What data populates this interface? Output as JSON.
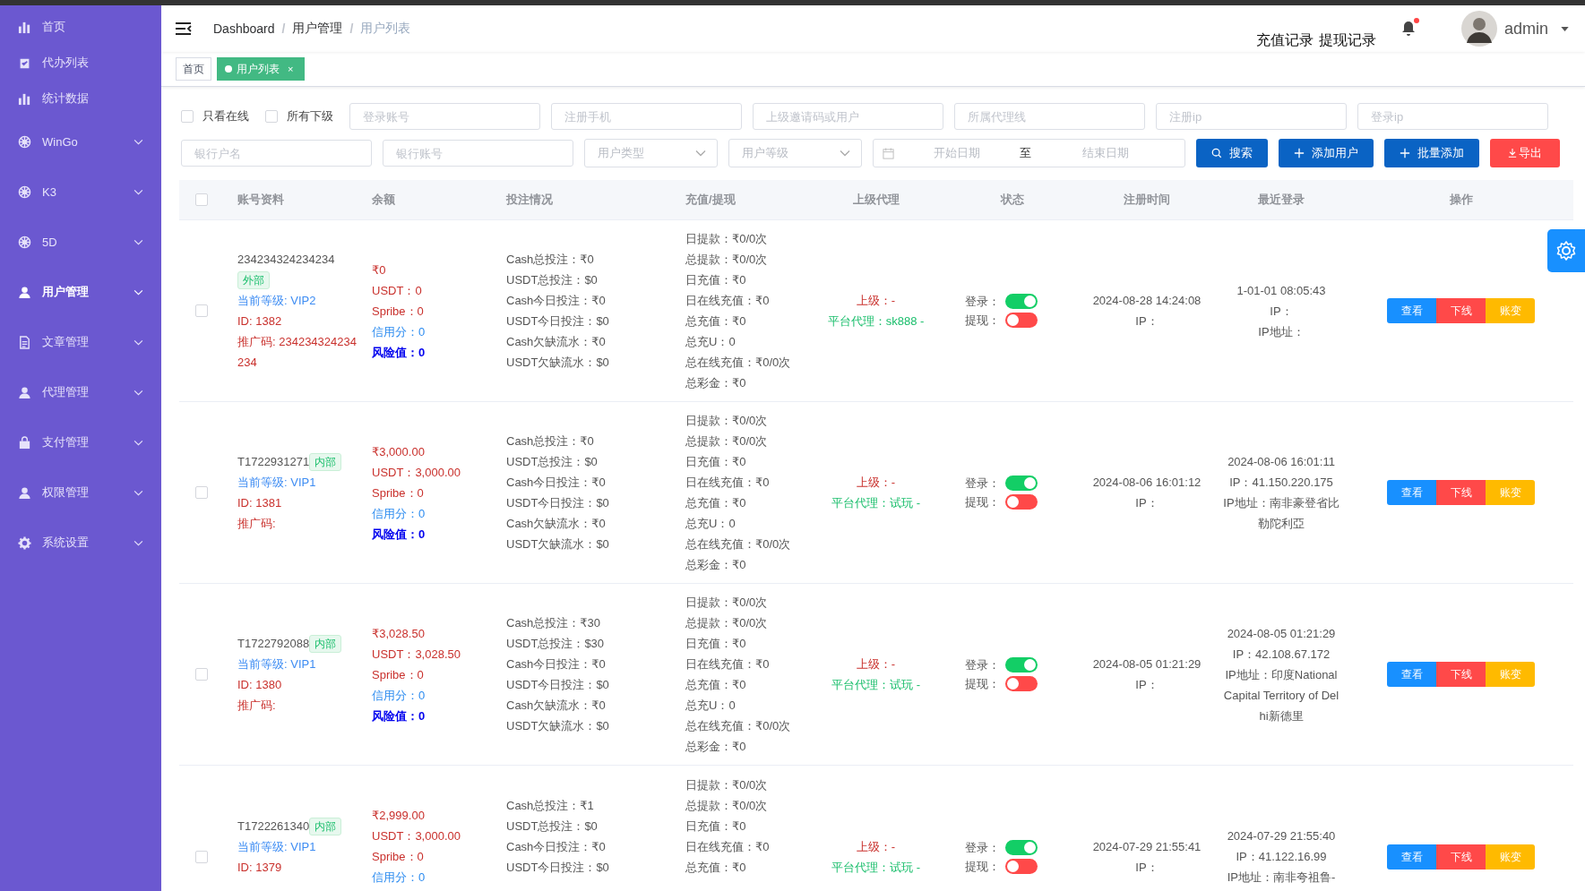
{
  "sidebar": {
    "items": [
      {
        "label": "首页",
        "expandable": false,
        "selected": false
      },
      {
        "label": "代办列表",
        "expandable": false,
        "selected": false
      },
      {
        "label": "统计数据",
        "expandable": false,
        "selected": false
      },
      {
        "label": "WinGo",
        "expandable": true,
        "selected": false
      },
      {
        "label": "K3",
        "expandable": true,
        "selected": false
      },
      {
        "label": "5D",
        "expandable": true,
        "selected": false
      },
      {
        "label": "用户管理",
        "expandable": true,
        "selected": true
      },
      {
        "label": "文章管理",
        "expandable": true,
        "selected": false
      },
      {
        "label": "代理管理",
        "expandable": true,
        "selected": false
      },
      {
        "label": "支付管理",
        "expandable": true,
        "selected": false
      },
      {
        "label": "权限管理",
        "expandable": true,
        "selected": false
      },
      {
        "label": "系统设置",
        "expandable": true,
        "selected": false
      }
    ]
  },
  "header": {
    "breadcrumb": [
      "Dashboard",
      "用户管理",
      "用户列表"
    ],
    "breadcrumb_separator": "/",
    "links": [
      "充值记录",
      "提现记录"
    ],
    "notification_dot": true,
    "user": "admin"
  },
  "tabs": [
    {
      "label": "首页",
      "selected": false
    },
    {
      "label": "用户列表",
      "selected": true,
      "close": "×"
    }
  ],
  "filters": {
    "checkboxes": [
      {
        "label": "只看在线",
        "checked": false
      },
      {
        "label": "所有下级",
        "checked": false
      }
    ],
    "row1_fields": [
      {
        "placeholder": "登录账号"
      },
      {
        "placeholder": "注册手机"
      },
      {
        "placeholder": "上级邀请码或用户"
      },
      {
        "placeholder": "所属代理线"
      },
      {
        "placeholder": "注册ip"
      },
      {
        "placeholder": "登录ip"
      }
    ],
    "row2_fields": [
      {
        "placeholder": "银行户名"
      },
      {
        "placeholder": "银行账号"
      }
    ],
    "selects": [
      "用户类型",
      "用户等级"
    ],
    "date_range": {
      "start": "开始日期",
      "separator": "至",
      "end": "结束日期"
    },
    "buttons": [
      {
        "label": "搜索",
        "kind": "search"
      },
      {
        "label": "添加用户",
        "kind": "add"
      },
      {
        "label": "批量添加",
        "kind": "add"
      },
      {
        "label": "导出",
        "kind": "export"
      }
    ]
  },
  "table": {
    "select_all_checked": false,
    "columns": [
      "账号资料",
      "余额",
      "投注情况",
      "充值/提现",
      "上级代理",
      "状态",
      "注册时间",
      "最近登录",
      "操作"
    ],
    "rows": [
      {
        "checked": false,
        "account": "234234324234234",
        "tag_line": "外部",
        "level": "当前等级: VIP2",
        "id": "ID: 1382",
        "promo": "推广码: 234234324234234",
        "balance": [
          {
            "text": "₹0",
            "kind": "amount"
          },
          {
            "text": "USDT：0",
            "kind": "amount"
          },
          {
            "text": "Spribe：0",
            "kind": "amount"
          },
          {
            "text": "信用分：0",
            "kind": "credit"
          },
          {
            "text": "风险值：0",
            "kind": "risk"
          }
        ],
        "bets": [
          "Cash总投注：₹0",
          "USDT总投注：$0",
          "Cash今日投注：₹0",
          "USDT今日投注：$0",
          "Cash欠缺流水：₹0",
          "USDT欠缺流水：$0"
        ],
        "funds": [
          "日提款：₹0/0次",
          "总提款：₹0/0次",
          "日充值：₹0",
          "日在线充值：₹0",
          "总充值：₹0",
          "总充U：0",
          "总在线充值：₹0/0次",
          "总彩金：₹0"
        ],
        "superior": "上级：-",
        "agent": "平台代理：sk888 -",
        "login_label": "登录：",
        "login_on": true,
        "withdraw_label": "提现：",
        "withdraw_on": false,
        "reg_time": "2024-08-28 14:24:08",
        "reg_ip": "IP：",
        "last_login": [
          "1-01-01 08:05:43",
          "IP：",
          "IP地址："
        ],
        "actions": [
          "查看",
          "下线",
          "账变"
        ]
      },
      {
        "checked": false,
        "account": "T1722931271",
        "tag": "内部",
        "level": "当前等级: VIP1",
        "id": "ID: 1381",
        "promo": "推广码:",
        "balance": [
          {
            "text": "₹3,000.00",
            "kind": "amount"
          },
          {
            "text": "USDT：3,000.00",
            "kind": "amount"
          },
          {
            "text": "Spribe：0",
            "kind": "amount"
          },
          {
            "text": "信用分：0",
            "kind": "credit"
          },
          {
            "text": "风险值：0",
            "kind": "risk"
          }
        ],
        "bets": [
          "Cash总投注：₹0",
          "USDT总投注：$0",
          "Cash今日投注：₹0",
          "USDT今日投注：$0",
          "Cash欠缺流水：₹0",
          "USDT欠缺流水：$0"
        ],
        "funds": [
          "日提款：₹0/0次",
          "总提款：₹0/0次",
          "日充值：₹0",
          "日在线充值：₹0",
          "总充值：₹0",
          "总充U：0",
          "总在线充值：₹0/0次",
          "总彩金：₹0"
        ],
        "superior": "上级：-",
        "agent": "平台代理：试玩 -",
        "login_label": "登录：",
        "login_on": true,
        "withdraw_label": "提现：",
        "withdraw_on": false,
        "reg_time": "2024-08-06 16:01:12",
        "reg_ip": "IP：",
        "last_login": [
          "2024-08-06 16:01:11",
          "IP：41.150.220.175",
          "IP地址：南非豪登省比勒陀利亞"
        ],
        "actions": [
          "查看",
          "下线",
          "账变"
        ]
      },
      {
        "checked": false,
        "account": "T1722792088",
        "tag": "内部",
        "level": "当前等级: VIP1",
        "id": "ID: 1380",
        "promo": "推广码:",
        "balance": [
          {
            "text": "₹3,028.50",
            "kind": "amount"
          },
          {
            "text": "USDT：3,028.50",
            "kind": "amount"
          },
          {
            "text": "Spribe：0",
            "kind": "amount"
          },
          {
            "text": "信用分：0",
            "kind": "credit"
          },
          {
            "text": "风险值：0",
            "kind": "risk"
          }
        ],
        "bets": [
          "Cash总投注：₹30",
          "USDT总投注：$30",
          "Cash今日投注：₹0",
          "USDT今日投注：$0",
          "Cash欠缺流水：₹0",
          "USDT欠缺流水：$0"
        ],
        "funds": [
          "日提款：₹0/0次",
          "总提款：₹0/0次",
          "日充值：₹0",
          "日在线充值：₹0",
          "总充值：₹0",
          "总充U：0",
          "总在线充值：₹0/0次",
          "总彩金：₹0"
        ],
        "superior": "上级：-",
        "agent": "平台代理：试玩 -",
        "login_label": "登录：",
        "login_on": true,
        "withdraw_label": "提现：",
        "withdraw_on": false,
        "reg_time": "2024-08-05 01:21:29",
        "reg_ip": "IP：",
        "last_login": [
          "2024-08-05 01:21:29",
          "IP：42.108.67.172",
          "IP地址：印度National Capital Territory of Delhi新德里"
        ],
        "actions": [
          "查看",
          "下线",
          "账变"
        ]
      },
      {
        "checked": false,
        "account": "T1722261340",
        "tag": "内部",
        "level": "当前等级: VIP1",
        "id": "ID: 1379",
        "balance": [
          {
            "text": "₹2,999.00",
            "kind": "amount"
          },
          {
            "text": "USDT：3,000.00",
            "kind": "amount"
          },
          {
            "text": "Spribe：0",
            "kind": "amount"
          },
          {
            "text": "信用分：0",
            "kind": "credit"
          }
        ],
        "bets": [
          "Cash总投注：₹1",
          "USDT总投注：$0",
          "Cash今日投注：₹0",
          "USDT今日投注：$0"
        ],
        "funds": [
          "日提款：₹0/0次",
          "总提款：₹0/0次",
          "日充值：₹0",
          "日在线充值：₹0",
          "总充值：₹0"
        ],
        "superior": "上级：-",
        "agent": "平台代理：试玩 -",
        "login_label": "登录：",
        "login_on": true,
        "withdraw_label": "提现：",
        "withdraw_on": false,
        "reg_time": "2024-07-29 21:55:41",
        "reg_ip": "IP：",
        "last_login": [
          "2024-07-29 21:55:40",
          "IP：41.122.16.99",
          "IP地址：南非夸祖鲁-"
        ],
        "actions": [
          "查看",
          "下线",
          "账变"
        ]
      }
    ]
  }
}
